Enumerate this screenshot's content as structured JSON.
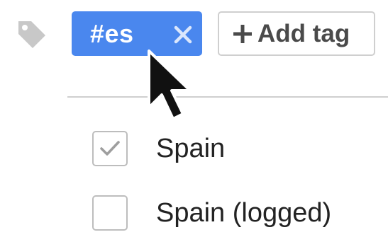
{
  "colors": {
    "tag_chip_bg": "#4a87ee",
    "tag_icon": "#c8c8c8",
    "checkmark": "#9e9e9e",
    "text": "#222222"
  },
  "tag": {
    "label": "#es",
    "remove_icon": "close-icon"
  },
  "add_tag": {
    "label": "Add tag",
    "icon": "plus-icon"
  },
  "options": [
    {
      "label": "Spain",
      "checked": true
    },
    {
      "label": "Spain (logged)",
      "checked": false
    }
  ]
}
